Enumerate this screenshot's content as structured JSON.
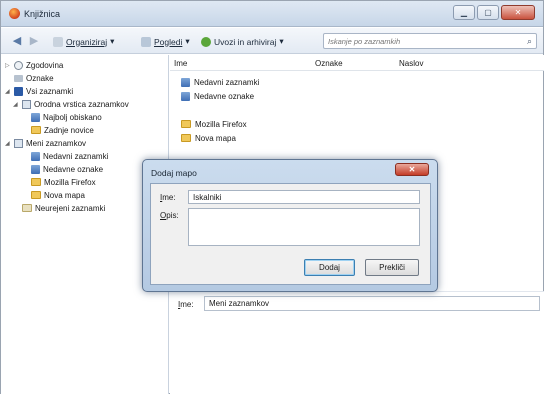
{
  "window": {
    "title": "Knjižnica",
    "controls": [
      "minimize",
      "maximize",
      "close"
    ]
  },
  "toolbar": {
    "back_icon": "back-arrow-icon",
    "forward_icon": "forward-arrow-icon",
    "organize_label": "Organiziraj",
    "views_label": "Pogledi",
    "import_label": "Uvozi in arhiviraj",
    "dropdown_glyph": "▾",
    "search_placeholder": "Iskanje po zaznamkih"
  },
  "tree": {
    "items": [
      {
        "label": "Zgodovina",
        "icon": "history-clock-icon"
      },
      {
        "label": "Oznake",
        "icon": "tag-icon"
      },
      {
        "label": "Vsi zaznamki",
        "icon": "all-bookmarks-icon"
      },
      {
        "label": "Orodna vrstica zaznamkov",
        "icon": "bookmarks-toolbar-icon"
      },
      {
        "label": "Najbolj obiskano",
        "icon": "bookmark-icon"
      },
      {
        "label": "Zadnje novice",
        "icon": "rss-folder-icon"
      },
      {
        "label": "Meni zaznamkov",
        "icon": "bookmarks-menu-icon"
      },
      {
        "label": "Nedavni zaznamki",
        "icon": "bookmark-icon"
      },
      {
        "label": "Nedavne oznake",
        "icon": "bookmark-icon"
      },
      {
        "label": "Mozilla Firefox",
        "icon": "folder-icon"
      },
      {
        "label": "Nova mapa",
        "icon": "folder-icon"
      },
      {
        "label": "Neurejeni zaznamki",
        "icon": "unsorted-bookmarks-icon"
      }
    ]
  },
  "list": {
    "columns": [
      "Ime",
      "Oznake",
      "Naslov"
    ],
    "rows": [
      {
        "label": "Nedavni zaznamki",
        "icon": "bookmark-icon"
      },
      {
        "label": "Nedavne oznake",
        "icon": "bookmark-icon"
      },
      {
        "label": "Mozilla Firefox",
        "icon": "folder-icon"
      },
      {
        "label": "Nova mapa",
        "icon": "folder-icon"
      }
    ]
  },
  "details": {
    "name_label_key": "I",
    "name_label_rest": "me:",
    "name_value": "Meni zaznamkov"
  },
  "dialog": {
    "title": "Dodaj mapo",
    "close_glyph": "✕",
    "name_label_key": "I",
    "name_label_rest": "me:",
    "name_value": "Iskalniki",
    "desc_label_key": "O",
    "desc_label_rest": "pis:",
    "desc_value": "",
    "add_button": "Dodaj",
    "cancel_button": "Prekliči"
  }
}
